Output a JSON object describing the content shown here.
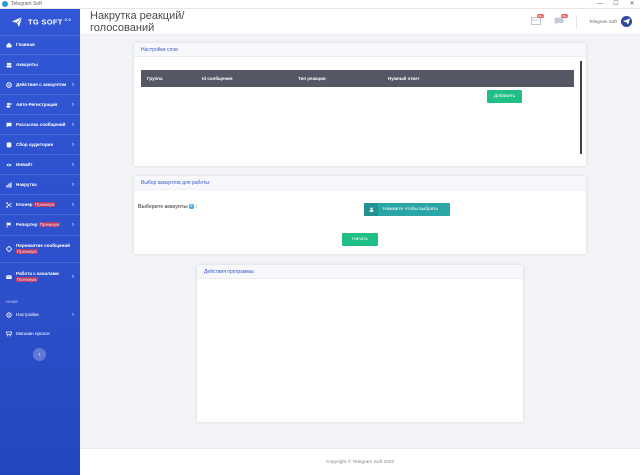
{
  "window": {
    "title": "Telegram Soft",
    "controls": [
      "—",
      "☐",
      "✕"
    ]
  },
  "brand": {
    "name": "TG SOFT",
    "version": "2.0"
  },
  "sidebar": {
    "items": [
      {
        "label": "Главная",
        "icon": "home-icon",
        "chevron": false
      },
      {
        "label": "Аккаунты",
        "icon": "users-icon",
        "chevron": false
      },
      {
        "label": "Действия с аккаунтом",
        "icon": "gear-icon",
        "chevron": true
      },
      {
        "label": "Авто-Регистрация",
        "icon": "user-plus-icon",
        "chevron": true
      },
      {
        "label": "Рассылка сообщений",
        "icon": "chat-icon",
        "chevron": true
      },
      {
        "label": "Сбор аудитории",
        "icon": "database-icon",
        "chevron": true
      },
      {
        "label": "Инвайт",
        "icon": "eye-icon",
        "chevron": true
      },
      {
        "label": "Накрутка",
        "icon": "chart-icon",
        "chevron": true
      },
      {
        "label": "Клонер",
        "premium": "Премиум",
        "icon": "clone-icon",
        "chevron": true
      },
      {
        "label": "Репортер",
        "premium": "Премиум",
        "icon": "flag-icon",
        "chevron": true
      },
      {
        "label": "Переваятие сообщений",
        "premium": "Премиум",
        "icon": "diamond-icon",
        "chevron": false
      },
      {
        "label": "Работа с каналами",
        "premium": "Премиум",
        "icon": "envelope-icon",
        "chevron": true
      }
    ],
    "section_label": "ИНШЕ",
    "extra_items": [
      {
        "label": "Настройки",
        "icon": "settings-icon",
        "chevron": true
      },
      {
        "label": "Магазин прокси",
        "icon": "shop-icon",
        "chevron": false
      }
    ],
    "collapse_icon": "‹"
  },
  "header": {
    "title": "Накрутка реакций/ голосований",
    "badge_1": "99+",
    "badge_2": "99+",
    "user": "Telegram Soft"
  },
  "word_settings": {
    "title": "Настройки слов",
    "columns": [
      "Группа",
      "Id сообщения",
      "Тип реакции",
      "Нужный ответ"
    ],
    "add_button": "Добавить"
  },
  "accounts": {
    "title": "Выбор аккаунтов для работы:",
    "choose_label": "Выберите аккаунты",
    "count": "0",
    "select_button": "Нажмите чтобы выбрать",
    "start_button": "Начать"
  },
  "log": {
    "title": "Действия программы:"
  },
  "footer": {
    "text": "Copyright © Telegram Soft 2020"
  },
  "colors": {
    "sidebar": "#3157d6",
    "accent_green": "#1fbf86",
    "accent_teal": "#2aa6a6",
    "card_title": "#3a5bc7"
  }
}
